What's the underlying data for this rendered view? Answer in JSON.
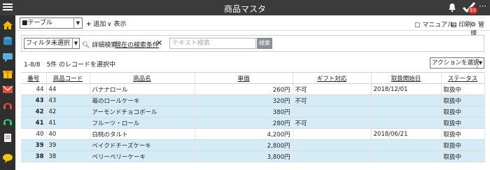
{
  "app": {
    "title": "商品マスタ",
    "notification_count": "93",
    "more_label": "⋯"
  },
  "toolbar": {
    "view_select": "■テーブル",
    "add_label": "追加",
    "display_label": "表示",
    "manual_label": "マニュアル",
    "print_label": "印刷",
    "admin_label": "管理"
  },
  "filter": {
    "select_value": "フィルタ未選択",
    "detail_search_label": "詳細検索",
    "current_conditions_label": "現在の検索条件",
    "clear_label": "✕",
    "text_search_placeholder": "テキスト検索",
    "search_button": "検索"
  },
  "records": {
    "info": "1-8/8　5件 のレコードを選択中",
    "action_select": "アクションを選択"
  },
  "table": {
    "columns": [
      "番号",
      "商品コード",
      "商品名",
      "単価",
      "ギフト対応",
      "取扱開始日",
      "ステータス"
    ],
    "rows": [
      {
        "no": "44",
        "code": "44",
        "name": "バナナロール",
        "price": "260円",
        "gift": "不可",
        "start": "2018/12/01",
        "status": "取扱中",
        "selected": false
      },
      {
        "no": "43",
        "code": "43",
        "name": "苺のロールケーキ",
        "price": "320円",
        "gift": "不可",
        "start": "",
        "status": "取扱中",
        "selected": true
      },
      {
        "no": "42",
        "code": "42",
        "name": "アーモンドチョコボール",
        "price": "380円",
        "gift": "",
        "start": "",
        "status": "取扱中",
        "selected": true
      },
      {
        "no": "41",
        "code": "41",
        "name": "フルーツ・ロール",
        "price": "280円",
        "gift": "不可",
        "start": "",
        "status": "取扱中",
        "selected": true
      },
      {
        "no": "40",
        "code": "40",
        "name": "白桃のタルト",
        "price": "4,200円",
        "gift": "",
        "start": "2018/06/21",
        "status": "取扱中",
        "selected": false
      },
      {
        "no": "39",
        "code": "39",
        "name": "ベイクドチーズケーキ",
        "price": "2,800円",
        "gift": "",
        "start": "",
        "status": "取扱中",
        "selected": true
      },
      {
        "no": "38",
        "code": "38",
        "name": "ベリーベリーケーキ",
        "price": "3,800円",
        "gift": "",
        "start": "",
        "status": "取扱中",
        "selected": true
      }
    ]
  },
  "icons": {
    "sidebar": [
      "home-icon",
      "database-icon",
      "chat-icon",
      "gift-icon",
      "mail-icon",
      "support-icon",
      "headset-icon",
      "document-icon",
      "comment-icon"
    ]
  },
  "colors": {
    "topbar": "#3b3b3b",
    "sidebar": "#2f2f2f",
    "selected_row": "#d3ecf8",
    "badge": "#e8231b",
    "search_button": "#8a8f99"
  }
}
